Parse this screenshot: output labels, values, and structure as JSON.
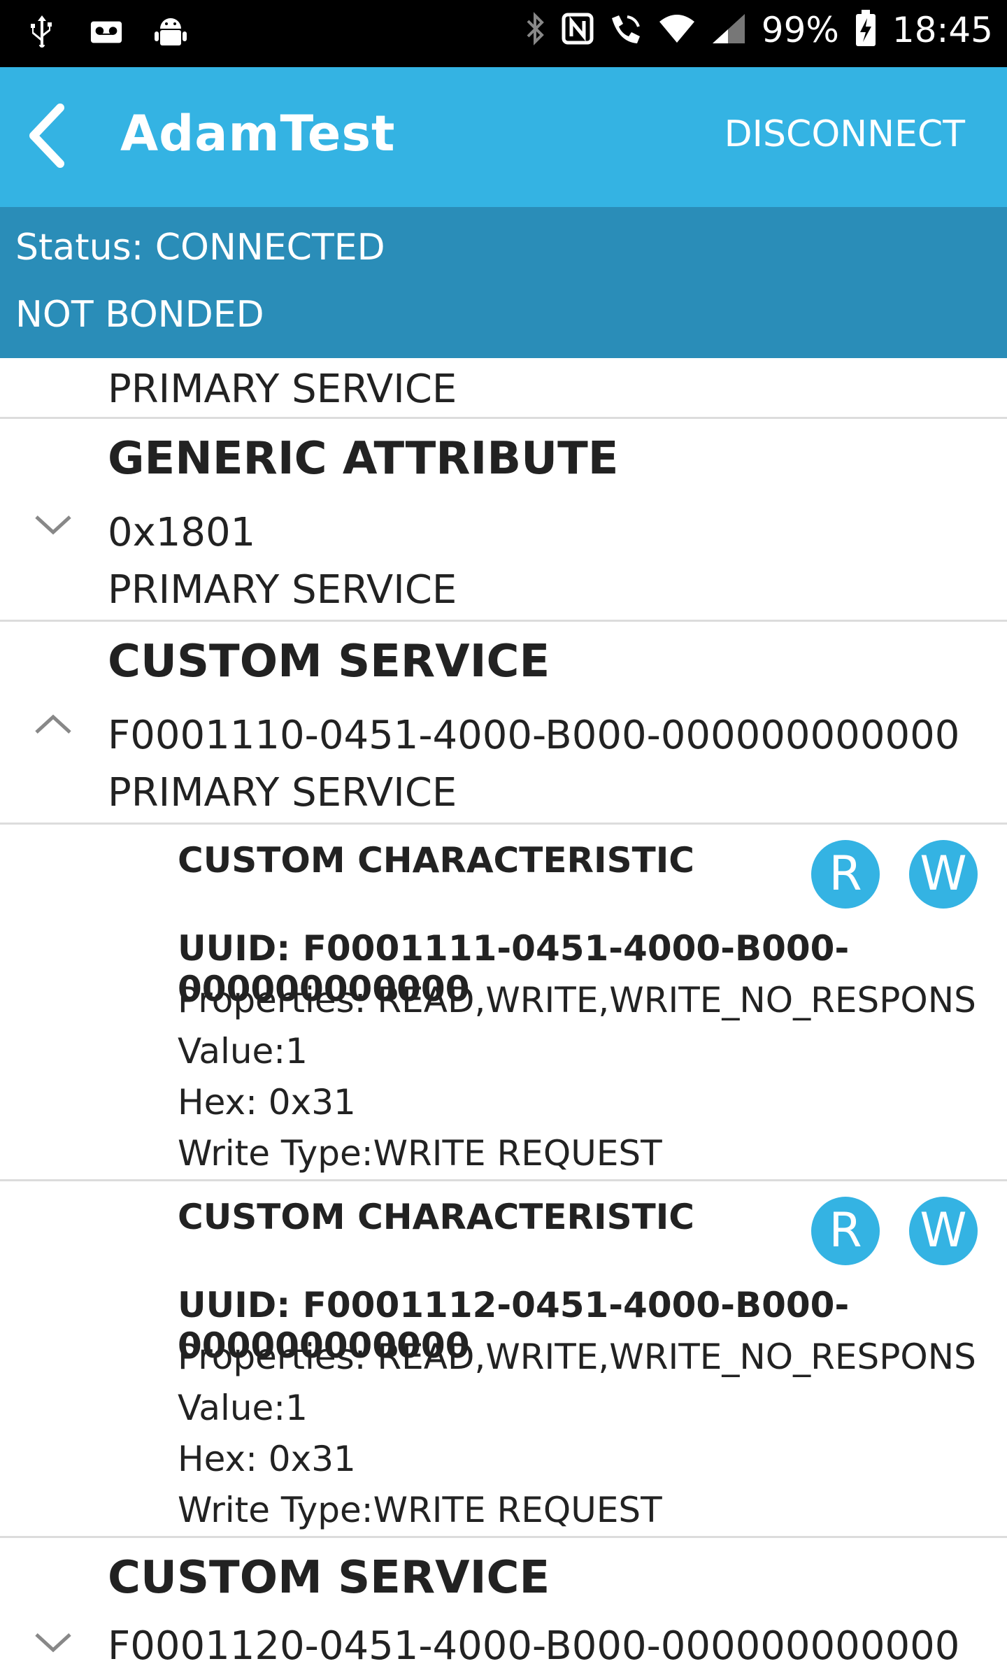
{
  "status_bar": {
    "battery": "99%",
    "time": "18:45"
  },
  "app_bar": {
    "title": "AdamTest",
    "action": "DISCONNECT"
  },
  "connection": {
    "status": "Status: CONNECTED",
    "bond": "NOT BONDED"
  },
  "services": [
    {
      "type": "PRIMARY SERVICE"
    },
    {
      "name": "GENERIC ATTRIBUTE",
      "uuid": "0x1801",
      "type": "PRIMARY SERVICE"
    },
    {
      "name": "CUSTOM SERVICE",
      "uuid": "F0001110-0451-4000-B000-000000000000",
      "type": "PRIMARY SERVICE"
    },
    {
      "name": "CUSTOM SERVICE",
      "uuid": "F0001120-0451-4000-B000-000000000000"
    }
  ],
  "characteristics": [
    {
      "name": "CUSTOM CHARACTERISTIC",
      "uuid": "UUID: F0001111-0451-4000-B000-000000000000",
      "properties": "Properties: READ,WRITE,WRITE_NO_RESPONS",
      "value": "Value:1",
      "hex": "Hex: 0x31",
      "write_type": "Write Type:WRITE REQUEST",
      "read_badge": "R",
      "write_badge": "W"
    },
    {
      "name": "CUSTOM CHARACTERISTIC",
      "uuid": "UUID: F0001112-0451-4000-B000-000000000000",
      "properties": "Properties: READ,WRITE,WRITE_NO_RESPONS",
      "value": "Value:1",
      "hex": "Hex: 0x31",
      "write_type": "Write Type:WRITE REQUEST",
      "read_badge": "R",
      "write_badge": "W"
    }
  ],
  "colors": {
    "app_bar": "#34b3e3",
    "status_panel": "#2a8db8",
    "badge": "#34b3e3"
  }
}
